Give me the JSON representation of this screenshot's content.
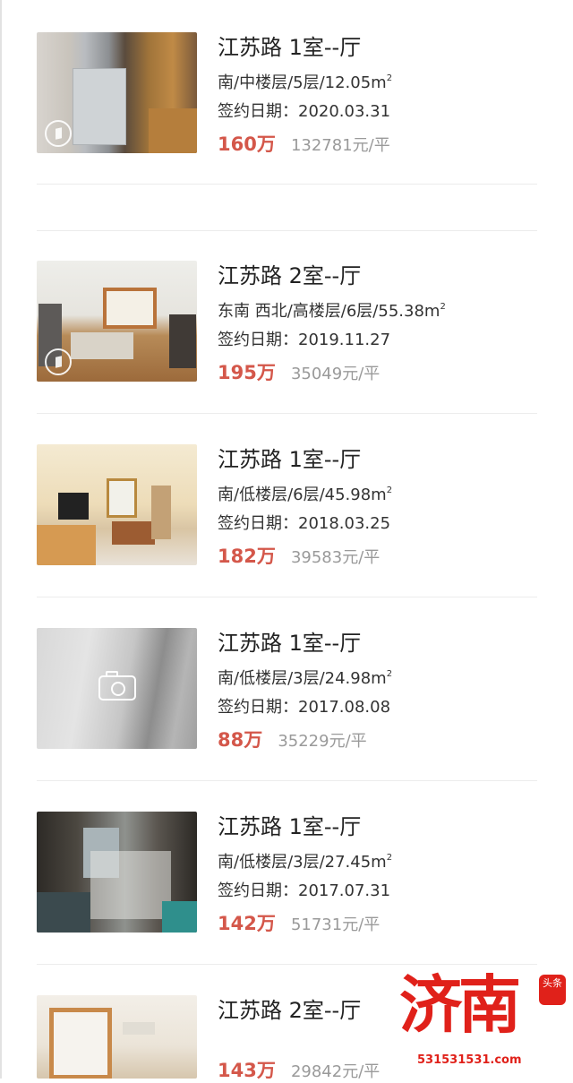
{
  "listings": [
    {
      "title": "江苏路 1室--厅",
      "detail": "南/中楼层/5层/12.05m",
      "sign": "签约日期：2020.03.31",
      "price": "160万",
      "unit_price": "132781元/平",
      "has_vr": true,
      "photo": "photo-room-fridge"
    },
    {
      "title": "江苏路 2室--厅",
      "detail": "东南 西北/高楼层/6层/55.38m",
      "sign": "签约日期：2019.11.27",
      "price": "195万",
      "unit_price": "35049元/平",
      "has_vr": true,
      "photo": "photo-bedroom"
    },
    {
      "title": "江苏路 1室--厅",
      "detail": "南/低楼层/6层/45.98m",
      "sign": "签约日期：2018.03.25",
      "price": "182万",
      "unit_price": "39583元/平",
      "has_vr": false,
      "photo": "photo-living-room"
    },
    {
      "title": "江苏路 1室--厅",
      "detail": "南/低楼层/3层/24.98m",
      "sign": "签约日期：2017.08.08",
      "price": "88万",
      "unit_price": "35229元/平",
      "has_vr": false,
      "photo": "placeholder-camera"
    },
    {
      "title": "江苏路 1室--厅",
      "detail": "南/低楼层/3层/27.45m",
      "sign": "签约日期：2017.07.31",
      "price": "142万",
      "unit_price": "51731元/平",
      "has_vr": false,
      "photo": "photo-messy-room"
    },
    {
      "title": "江苏路 2室--厅",
      "detail": "",
      "sign": "",
      "price": "143万",
      "unit_price": "29842元/平",
      "has_vr": false,
      "photo": "photo-room-window"
    }
  ],
  "area_superscript": "2",
  "watermark": {
    "text": "济南",
    "badge": "头条",
    "url": "531531531.com"
  },
  "colors": {
    "price": "#d4574a",
    "unit_price": "#9a9a9a",
    "watermark": "#e0211a"
  }
}
